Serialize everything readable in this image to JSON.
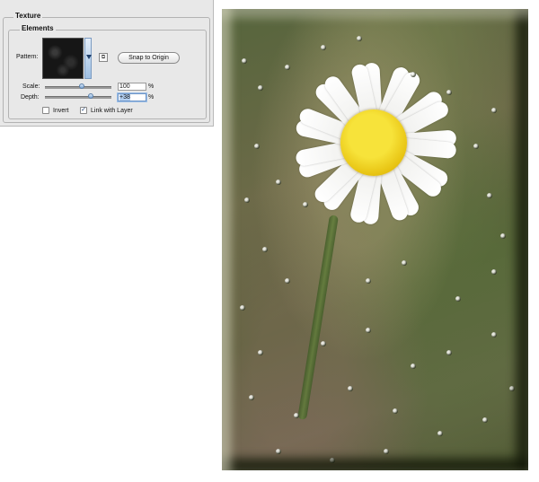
{
  "panel": {
    "section_title": "Texture",
    "group_title": "Elements",
    "pattern_label": "Pattern:",
    "snap_button": "Snap to Origin",
    "new_preset_glyph": "⧉",
    "scale": {
      "label": "Scale:",
      "value": "100",
      "unit": "%",
      "slider_fraction": 0.55
    },
    "depth": {
      "label": "Depth:",
      "value": "+38",
      "unit": "%",
      "slider_fraction": 0.69
    },
    "invert": {
      "label": "Invert",
      "checked": false
    },
    "link_with_layer": {
      "label": "Link with Layer",
      "checked": true,
      "check_glyph": "✓"
    }
  },
  "preview": {
    "subject": "daisy-photo-with-texture-and-bevel",
    "accent_colors": {
      "petal": "#ffffff",
      "center": "#f2d623",
      "background": "#5e6a40"
    }
  }
}
